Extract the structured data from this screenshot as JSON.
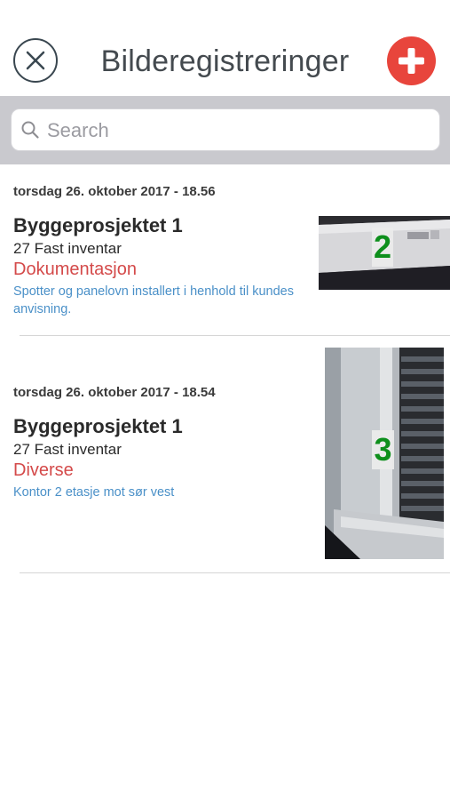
{
  "header": {
    "title": "Bilderegistreringer",
    "close_icon": "close-circle-icon",
    "add_icon": "plus-icon",
    "accent_color": "#e8453c"
  },
  "search": {
    "placeholder": "Search",
    "value": ""
  },
  "entries": [
    {
      "date": "torsdag 26. oktober 2017 - 18.56",
      "project": "Byggeprosjektet 1",
      "item": "27 Fast inventar",
      "category": "Dokumentasjon",
      "description": "Spotter og panelovn installert i henhold til kundes anvisning.",
      "photo_number": "2"
    },
    {
      "date": "torsdag 26. oktober 2017 - 18.54",
      "project": "Byggeprosjektet 1",
      "item": "27 Fast inventar",
      "category": "Diverse",
      "description": "Kontor 2 etasje mot sør vest",
      "photo_number": "3"
    }
  ]
}
